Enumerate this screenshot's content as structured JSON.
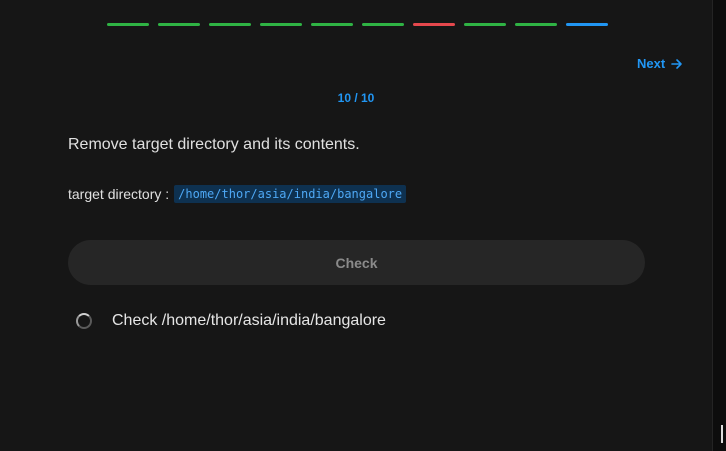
{
  "progress": {
    "segments": [
      {
        "status": "correct",
        "color": "#2fb344"
      },
      {
        "status": "correct",
        "color": "#2fb344"
      },
      {
        "status": "correct",
        "color": "#2fb344"
      },
      {
        "status": "correct",
        "color": "#2fb344"
      },
      {
        "status": "correct",
        "color": "#2fb344"
      },
      {
        "status": "correct",
        "color": "#2fb344"
      },
      {
        "status": "wrong",
        "color": "#e5484d"
      },
      {
        "status": "correct",
        "color": "#2fb344"
      },
      {
        "status": "correct",
        "color": "#2fb344"
      },
      {
        "status": "current",
        "color": "#2196f3"
      }
    ]
  },
  "nav": {
    "next_label": "Next",
    "next_icon": "arrow-right-icon"
  },
  "counter": "10 / 10",
  "question": {
    "text": "Remove target directory and its contents.",
    "target_label": "target directory :",
    "target_value": "/home/thor/asia/india/bangalore"
  },
  "check_button": {
    "label": "Check"
  },
  "checks": [
    {
      "label": "Check /home/thor/asia/india/bangalore",
      "state": "pending",
      "icon": "spinner-icon"
    }
  ],
  "colors": {
    "background": "#161616",
    "accent": "#2196f3",
    "correct": "#2fb344",
    "wrong": "#e5484d"
  }
}
